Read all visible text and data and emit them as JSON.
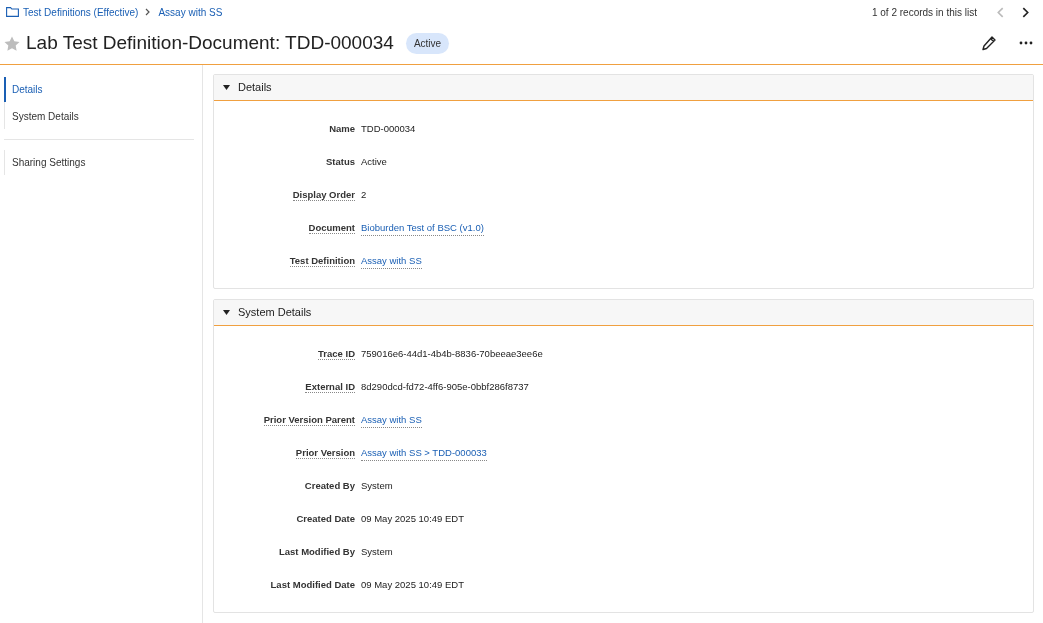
{
  "breadcrumb": [
    {
      "label": "Test Definitions (Effective)",
      "kind": "folder"
    },
    {
      "label": "Assay with SS",
      "kind": "link"
    }
  ],
  "record_nav": {
    "text": "1 of 2 records in this list",
    "previous_disabled": true,
    "next_disabled": false
  },
  "header": {
    "title": "Lab Test Definition-Document: TDD-000034",
    "favorite": false,
    "status_badge": "Active"
  },
  "sidebar": {
    "groups": [
      {
        "items": [
          {
            "label": "Details",
            "selected": true
          },
          {
            "label": "System Details",
            "selected": false
          }
        ]
      },
      {
        "items": [
          {
            "label": "Sharing Settings",
            "selected": false
          }
        ]
      }
    ]
  },
  "sections": [
    {
      "title": "Details",
      "expanded": true,
      "fields": [
        {
          "label": "Name",
          "help": false,
          "kind": "text",
          "value": "TDD-000034"
        },
        {
          "label": "Status",
          "help": false,
          "kind": "text",
          "value": "Active"
        },
        {
          "label": "Display Order",
          "help": true,
          "kind": "text",
          "value": "2"
        },
        {
          "label": "Document",
          "help": true,
          "kind": "link",
          "value": "Bioburden Test of BSC (v1.0)"
        },
        {
          "label": "Test Definition",
          "help": true,
          "kind": "link",
          "value": "Assay with SS"
        }
      ]
    },
    {
      "title": "System Details",
      "expanded": true,
      "fields": [
        {
          "label": "Trace ID",
          "help": true,
          "kind": "text",
          "value": "759016e6-44d1-4b4b-8836-70beeae3ee6e"
        },
        {
          "label": "External ID",
          "help": true,
          "kind": "text",
          "value": "8d290dcd-fd72-4ff6-905e-0bbf286f8737"
        },
        {
          "label": "Prior Version Parent",
          "help": true,
          "kind": "link",
          "value": "Assay with SS"
        },
        {
          "label": "Prior Version",
          "help": true,
          "kind": "link",
          "value": "Assay with SS > TDD-000033"
        },
        {
          "label": "Created By",
          "help": false,
          "kind": "text",
          "value": "System"
        },
        {
          "label": "Created Date",
          "help": false,
          "kind": "text",
          "value": "09 May 2025 10:49 EDT"
        },
        {
          "label": "Last Modified By",
          "help": false,
          "kind": "text",
          "value": "System"
        },
        {
          "label": "Last Modified Date",
          "help": false,
          "kind": "text",
          "value": "09 May 2025 10:49 EDT"
        }
      ]
    }
  ]
}
